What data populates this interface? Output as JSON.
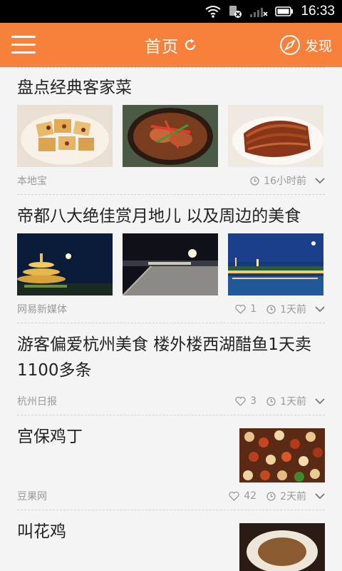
{
  "status": {
    "time": "16:33"
  },
  "header": {
    "title": "首页",
    "discover_label": "发现"
  },
  "feed": {
    "items": [
      {
        "title": "盘点经典客家菜",
        "source": "本地宝",
        "likes": null,
        "time": "16小时前"
      },
      {
        "title": "帝都八大绝佳赏月地儿 以及周边的美食",
        "source": "网易新媒体",
        "likes": "1",
        "time": "1天前"
      },
      {
        "title": "游客偏爱杭州美食 楼外楼西湖醋鱼1天卖1100多条",
        "source": "杭州日报",
        "likes": "3",
        "time": "1天前"
      },
      {
        "title": "宫保鸡丁",
        "source": "豆果网",
        "likes": "42",
        "time": "2天前"
      },
      {
        "title": "叫花鸡"
      }
    ]
  },
  "colors": {
    "header": "#f7803b",
    "statusbar": "#000000",
    "meta": "#999999"
  }
}
